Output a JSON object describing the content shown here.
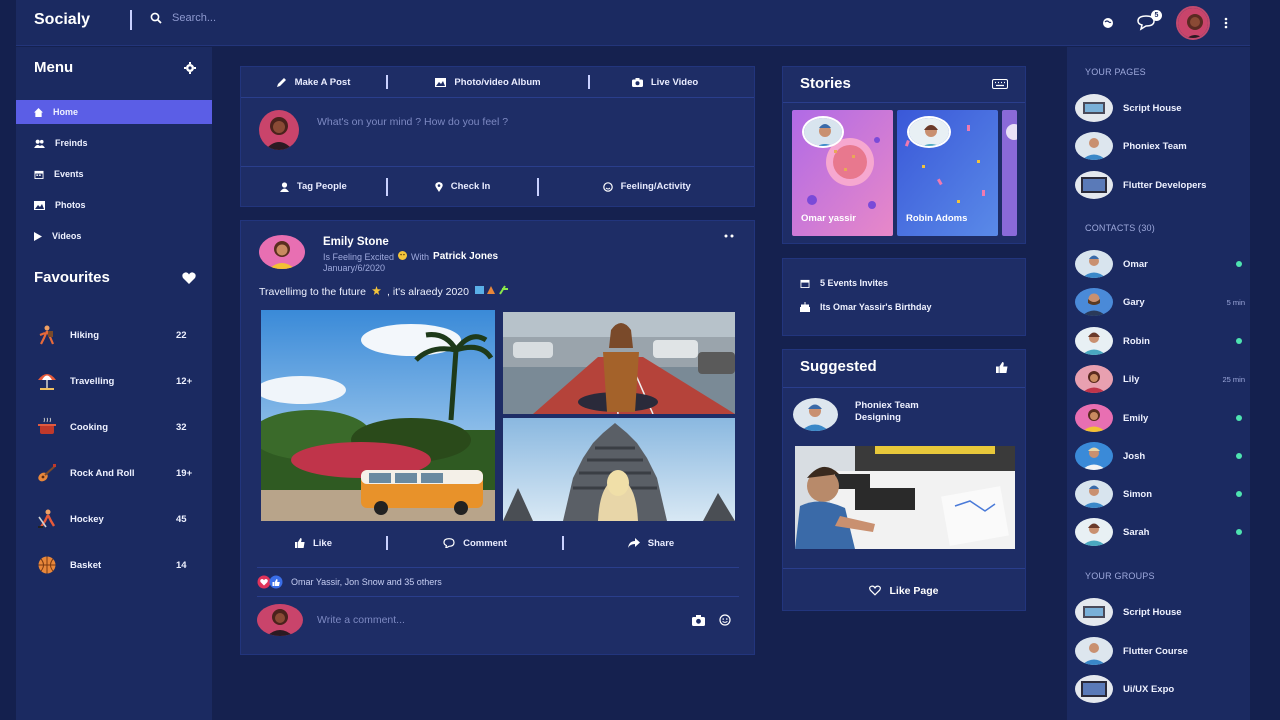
{
  "app": {
    "title": "Socialy"
  },
  "search": {
    "placeholder": "Search..."
  },
  "topbar": {
    "notification_count": "5"
  },
  "menu": {
    "title": "Menu",
    "items": [
      {
        "label": "Home",
        "icon": "home-icon"
      },
      {
        "label": "Freinds",
        "icon": "friends-icon"
      },
      {
        "label": "Events",
        "icon": "calendar-icon"
      },
      {
        "label": "Photos",
        "icon": "photos-icon"
      },
      {
        "label": "Videos",
        "icon": "play-icon"
      }
    ],
    "active_index": 0
  },
  "favourites": {
    "title": "Favourites",
    "items": [
      {
        "label": "Hiking",
        "count": "22"
      },
      {
        "label": "Travelling",
        "count": "12+"
      },
      {
        "label": "Cooking",
        "count": "32"
      },
      {
        "label": "Rock And Roll",
        "count": "19+"
      },
      {
        "label": "Hockey",
        "count": "45"
      },
      {
        "label": "Basket",
        "count": "14"
      }
    ]
  },
  "create_post": {
    "make_post": "Make A Post",
    "album": "Photo/video Album",
    "live": "Live Video",
    "placeholder": "What's on your mind ? How do you feel ?",
    "tag": "Tag People",
    "checkin": "Check In",
    "feeling": "Feeling/Activity"
  },
  "post": {
    "author": "Emily Stone",
    "feeling_prefix": "Is Feeling Excited",
    "with_label": "With",
    "with_user": "Patrick Jones",
    "date": "January/6/2020",
    "text": "Travellimg to the future",
    "text_2": ", it's alraedy 2020",
    "like": "Like",
    "comment": "Comment",
    "share": "Share",
    "likes_summary": "Omar Yassir, Jon Snow and 35 others",
    "comment_placeholder": "Write a comment..."
  },
  "stories": {
    "title": "Stories",
    "items": [
      {
        "name": "Omar yassir"
      },
      {
        "name": "Robin Adoms"
      }
    ]
  },
  "events": {
    "items": [
      {
        "label": "5 Events Invites"
      },
      {
        "label": "Its Omar Yassir's Birthday"
      }
    ]
  },
  "suggested": {
    "title": "Suggested",
    "page_name": "Phoniex Team",
    "page_sub": "Designing",
    "like_page": "Like Page"
  },
  "right": {
    "your_pages_title": "YOUR PAGES",
    "pages": [
      {
        "name": "Script House"
      },
      {
        "name": "Phoniex Team"
      },
      {
        "name": "Flutter Developers"
      }
    ],
    "contacts_title": "CONTACTS (30)",
    "contacts": [
      {
        "name": "Omar",
        "status": "online"
      },
      {
        "name": "Gary",
        "status": "5 min"
      },
      {
        "name": "Robin",
        "status": "online"
      },
      {
        "name": "Lily",
        "status": "25 min"
      },
      {
        "name": "Emily",
        "status": "online"
      },
      {
        "name": "Josh",
        "status": "online"
      },
      {
        "name": "Simon",
        "status": "online"
      },
      {
        "name": "Sarah",
        "status": "online"
      }
    ],
    "groups_title": "YOUR GROUPS",
    "groups": [
      {
        "name": "Script House"
      },
      {
        "name": "Flutter Course"
      },
      {
        "name": "Ui/UX Expo"
      }
    ]
  },
  "colors": {
    "accent": "#5b5ee6",
    "panel": "#1e2d66",
    "background": "#15214f",
    "online": "#4ee3b0"
  }
}
